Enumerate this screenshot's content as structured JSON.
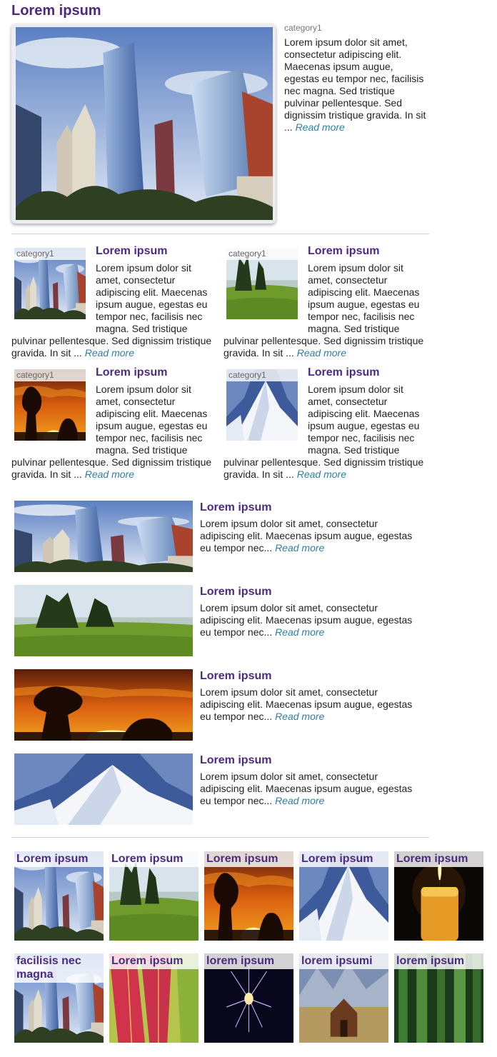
{
  "featured": {
    "title": "Lorem ipsum",
    "category": "category1",
    "text": "Lorem ipsum dolor sit amet, consectetur adipiscing elit. Maecenas ipsum augue, egestas eu tempor nec, facilisis nec magna. Sed tristique pulvinar pellentesque. Sed dignissim tristique gravida. In sit ...",
    "read_more": "Read more"
  },
  "two_col": [
    {
      "title": "Lorem ipsum",
      "category": "category1",
      "image": "skyscrapers",
      "line1": "Lorem ipsum dolor sit",
      "line2": "amet, consectetur",
      "line3": "adipiscing elit. Maecenas",
      "line4": "ipsum augue, egestas eu",
      "line5": "tempor nec, facilisis nec",
      "line6": "magna. Sed tristique",
      "line7": "pulvinar pellentesque. Sed dignissim tristique",
      "line8": "gravida. In sit ...",
      "read_more": "Read more"
    },
    {
      "title": "Lorem ipsum",
      "category": "category1",
      "image": "meadow",
      "line1": "Lorem ipsum dolor sit",
      "line2": "amet, consectetur",
      "line3": "adipiscing elit. Maecenas",
      "line4": "ipsum augue, egestas eu",
      "line5": "tempor nec, facilisis nec",
      "line6": "magna. Sed tristique",
      "line7": "pulvinar pellentesque. Sed dignissim tristique",
      "line8": "gravida. In sit ...",
      "read_more": "Read more"
    },
    {
      "title": "Lorem ipsum",
      "category": "category1",
      "image": "sunset",
      "line1": "Lorem ipsum dolor sit",
      "line2": "amet, consectetur",
      "line3": "adipiscing elit. Maecenas",
      "line4": "ipsum augue, egestas eu",
      "line5": "tempor nec, facilisis nec",
      "line6": "magna. Sed tristique",
      "line7": "pulvinar pellentesque. Sed dignissim tristique",
      "line8": "gravida. In sit ...",
      "read_more": "Read more"
    },
    {
      "title": "Lorem ipsum",
      "category": "category1",
      "image": "mountain",
      "line1": "Lorem ipsum dolor sit",
      "line2": "amet, consectetur",
      "line3": "adipiscing elit. Maecenas",
      "line4": "ipsum augue, egestas eu",
      "line5": "tempor nec, facilisis nec",
      "line6": "magna. Sed tristique",
      "line7": "pulvinar pellentesque. Sed dignissim tristique",
      "line8": "gravida. In sit ...",
      "read_more": "Read more"
    }
  ],
  "list": [
    {
      "title": "Lorem ipsum",
      "image": "skyscrapers",
      "line1": "Lorem ipsum dolor sit amet, consectetur",
      "line2": "adipiscing elit. Maecenas ipsum augue, egestas",
      "line3": "eu tempor nec...",
      "read_more": "Read more"
    },
    {
      "title": "Lorem ipsum",
      "image": "meadow",
      "line1": "Lorem ipsum dolor sit amet, consectetur",
      "line2": "adipiscing elit. Maecenas ipsum augue, egestas",
      "line3": "eu tempor nec...",
      "read_more": "Read more"
    },
    {
      "title": "Lorem ipsum",
      "image": "sunset",
      "line1": "Lorem ipsum dolor sit amet, consectetur",
      "line2": "adipiscing elit. Maecenas ipsum augue, egestas",
      "line3": "eu tempor nec...",
      "read_more": "Read more"
    },
    {
      "title": "Lorem ipsum",
      "image": "mountain",
      "line1": "Lorem ipsum dolor sit amet, consectetur",
      "line2": "adipiscing elit. Maecenas ipsum augue, egestas",
      "line3": "eu tempor nec...",
      "read_more": "Read more"
    }
  ],
  "grid": [
    {
      "title": "Lorem ipsum",
      "image": "skyscrapers"
    },
    {
      "title": "Lorem ipsum",
      "image": "meadow"
    },
    {
      "title": "Lorem ipsum",
      "image": "sunset"
    },
    {
      "title": "Lorem ipsum",
      "image": "mountain"
    },
    {
      "title": "Lorem ipsum",
      "image": "candle"
    },
    {
      "title": "facilisis nec magna",
      "image": "skyscrapers"
    },
    {
      "title": "Lorem ipsum",
      "image": "leaves"
    },
    {
      "title": "lorem ipsum",
      "image": "fireworks"
    },
    {
      "title": "lorem ipsumi",
      "image": "barn"
    },
    {
      "title": "lorem ipsum",
      "image": "forest"
    }
  ],
  "colors": {
    "title": "#4b2a82",
    "read_more": "#2f7fa3",
    "divider": "#cfcfcf"
  }
}
